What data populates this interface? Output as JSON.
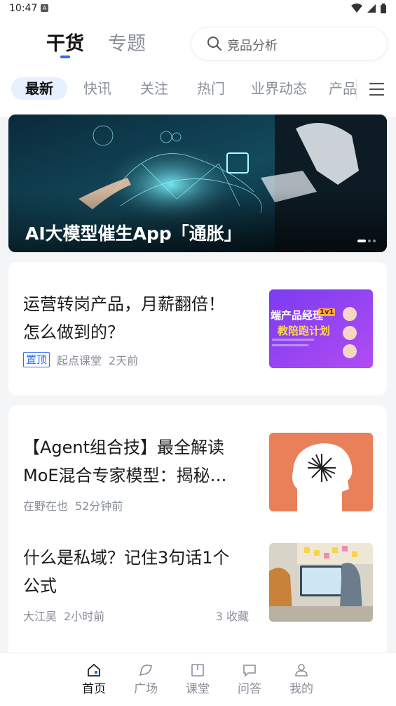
{
  "status": {
    "time": "10:47"
  },
  "top_tabs": [
    {
      "label": "干货",
      "active": true
    },
    {
      "label": "专题",
      "active": false
    }
  ],
  "search": {
    "placeholder": "竞品分析"
  },
  "channels": [
    "最新",
    "快讯",
    "关注",
    "热门",
    "业界动态",
    "产品"
  ],
  "banner": {
    "title": "AI大模型催生App「通胀」",
    "page_count": 3,
    "active_index": 0
  },
  "articles": [
    {
      "title": "运营转岗产品，月薪翻倍！怎么做到的？",
      "pinned_label": "置顶",
      "author": "起点课堂",
      "time": "2天前",
      "thumb_text_1": "端产品经理",
      "thumb_text_2": "教陪跑计划",
      "thumb_badge": "1v1"
    },
    {
      "title": "【Agent组合技】最全解读MoE混合专家模型：揭秘…",
      "author": "在野在也",
      "time": "52分钟前"
    },
    {
      "title": "什么是私域？记住3句话1个公式",
      "author": "大江吴",
      "time": "2小时前",
      "favorites": "3 收藏"
    }
  ],
  "bottom_nav": [
    {
      "label": "首页",
      "active": true
    },
    {
      "label": "广场",
      "active": false
    },
    {
      "label": "课堂",
      "active": false
    },
    {
      "label": "问答",
      "active": false
    },
    {
      "label": "我的",
      "active": false
    }
  ],
  "colors": {
    "accent": "#2f6cf6",
    "muted": "#8a8f99"
  }
}
